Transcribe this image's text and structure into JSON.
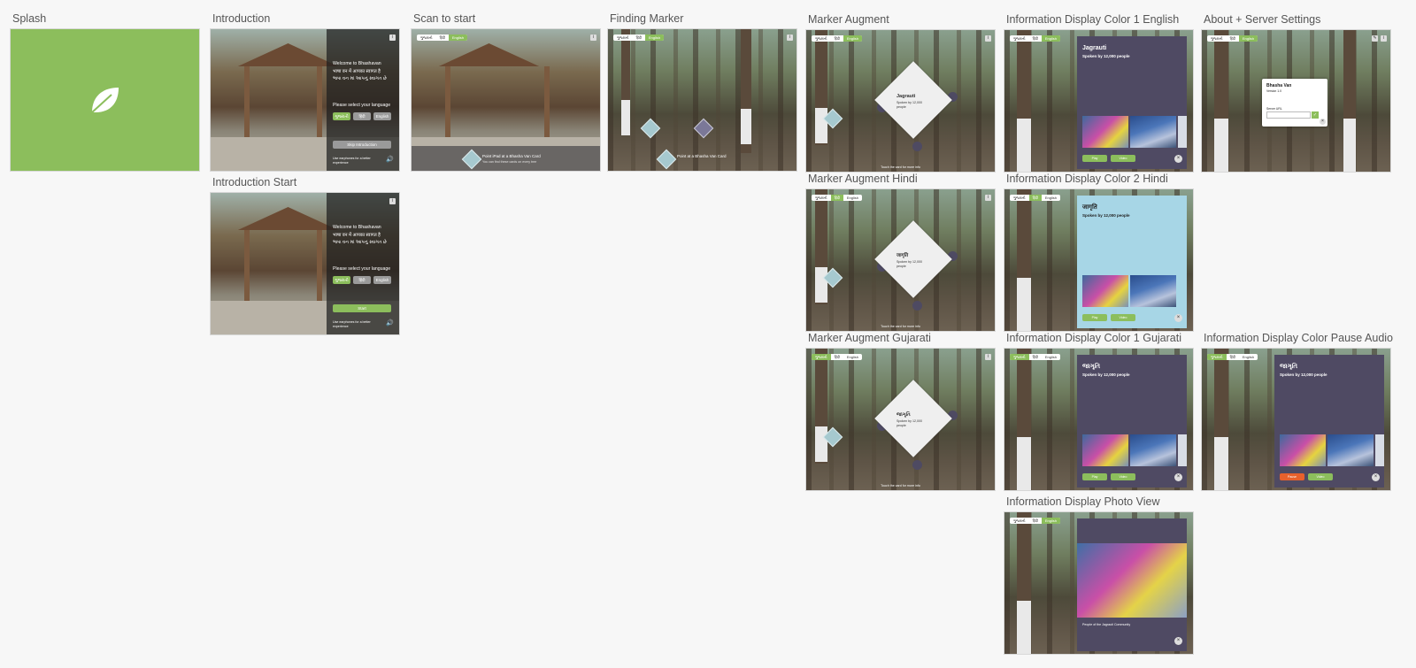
{
  "boards": {
    "splash": "Splash",
    "intro": "Introduction",
    "intro_start": "Introduction Start",
    "scan": "Scan to start",
    "finding": "Finding Marker",
    "augment": "Marker Augment",
    "augment_hindi": "Marker Augment Hindi",
    "augment_gujarati": "Marker Augment Gujarati",
    "info_en": "Information Display Color 1 English",
    "info_hi": "Information Display Color 2 Hindi",
    "info_gu": "Information Display Color 1 Gujarati",
    "info_photo": "Information Display Photo View",
    "about": "About + Server Settings",
    "pause": "Information Display Color Pause Audio"
  },
  "languages": [
    "ગુજરાતી",
    "हिंदी",
    "English"
  ],
  "intro": {
    "welcome": "Welcome to Bhashavan",
    "hindi_line": "भाषा वन में आपका स्वागत है",
    "gujarati_line": "ભાષા વન માં આપનું સ્વાગત છે",
    "select": "Please select your language",
    "skip": "Skip Introduction",
    "start": "Start",
    "footer": "Use earphones for a better experience"
  },
  "scan": {
    "prompt": "Point iPad at a Bhasha Van Card",
    "sub": "You can find these cards on every tree"
  },
  "finding": {
    "prompt": "Point at a Bhasha Van Card"
  },
  "augment": {
    "title_en": "Jagrauti",
    "title_hi": "जागृति",
    "title_gu": "જાગૃતિ",
    "hint": "Touch the card for more info"
  },
  "info": {
    "title_en": "Jagrauti",
    "title_hi": "जागृति",
    "title_gu": "જાગૃતિ",
    "spoken": "Spoken by 12,000 people",
    "play": "Play",
    "pause": "Pause",
    "video": "Video",
    "photo_caption": "People of the Jagrauti Community"
  },
  "about": {
    "title": "Bhasha Van",
    "version": "Version 1.0",
    "server_label": "Server URL"
  },
  "colors": {
    "green": "#8cbe5c",
    "purple": "#4f4a63",
    "blue": "#a7d6e6",
    "orange": "#e8612c"
  }
}
